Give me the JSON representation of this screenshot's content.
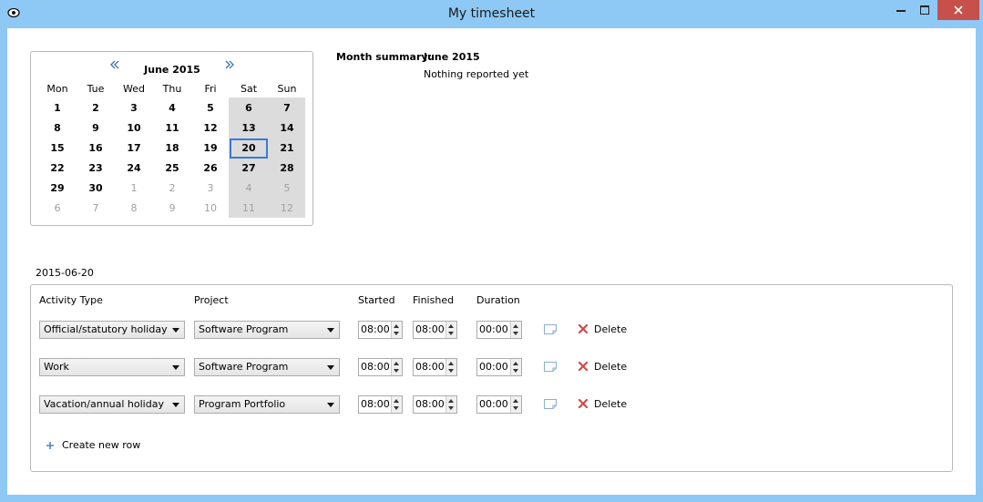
{
  "window": {
    "title": "My timesheet",
    "accent": "#8ec9f5",
    "close_color": "#c7504a"
  },
  "calendar": {
    "title": "June 2015",
    "weekdays": [
      "Mon",
      "Tue",
      "Wed",
      "Thu",
      "Fri",
      "Sat",
      "Sun"
    ],
    "weeks": [
      [
        "1",
        "2",
        "3",
        "4",
        "5",
        "6",
        "7"
      ],
      [
        "8",
        "9",
        "10",
        "11",
        "12",
        "13",
        "14"
      ],
      [
        "15",
        "16",
        "17",
        "18",
        "19",
        "20",
        "21"
      ],
      [
        "22",
        "23",
        "24",
        "25",
        "26",
        "27",
        "28"
      ],
      [
        "29",
        "30",
        "1",
        "2",
        "3",
        "4",
        "5"
      ],
      [
        "6",
        "7",
        "8",
        "9",
        "10",
        "11",
        "12"
      ]
    ],
    "selected_day": "20"
  },
  "summary": {
    "label": "Month summary:",
    "month": "June 2015",
    "text": "Nothing reported yet"
  },
  "date_label": "2015-06-20",
  "table": {
    "headers": {
      "activity": "Activity Type",
      "project": "Project",
      "started": "Started",
      "finished": "Finished",
      "duration": "Duration"
    },
    "rows": [
      {
        "activity": "Official/statutory holiday",
        "project": "Software Program",
        "started": "08:00",
        "finished": "08:00",
        "duration": "00:00",
        "delete": "Delete"
      },
      {
        "activity": "Work",
        "project": "Software Program",
        "started": "08:00",
        "finished": "08:00",
        "duration": "00:00",
        "delete": "Delete"
      },
      {
        "activity": "Vacation/annual holiday",
        "project": "Program Portfolio",
        "started": "08:00",
        "finished": "08:00",
        "duration": "00:00",
        "delete": "Delete"
      }
    ],
    "create_label": "Create new row"
  }
}
